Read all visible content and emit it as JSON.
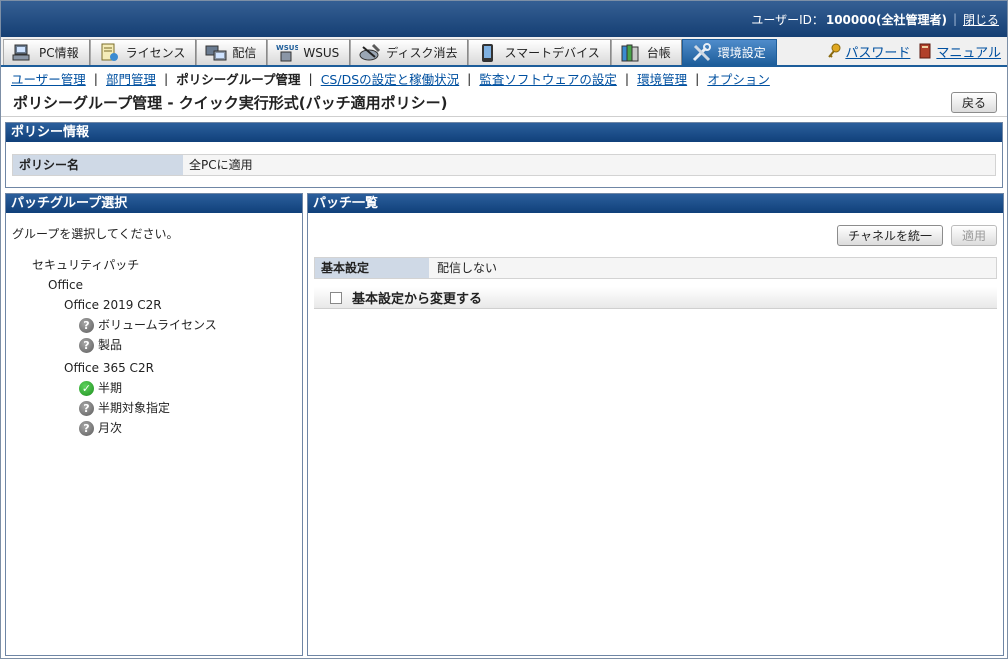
{
  "header": {
    "user_label": "ユーザーID：",
    "user_id": "100000(全社管理者)",
    "close_label": "閉じる"
  },
  "tabs": [
    {
      "label": "PC情報",
      "icon": "pc-icon"
    },
    {
      "label": "ライセンス",
      "icon": "license-icon"
    },
    {
      "label": "配信",
      "icon": "distribution-icon"
    },
    {
      "label": "WSUS",
      "icon": "wsus-icon"
    },
    {
      "label": "ディスク消去",
      "icon": "disk-erase-icon"
    },
    {
      "label": "スマートデバイス",
      "icon": "smart-device-icon"
    },
    {
      "label": "台帳",
      "icon": "ledger-icon"
    },
    {
      "label": "環境設定",
      "icon": "settings-tools-icon",
      "active": true
    }
  ],
  "tab_links": {
    "password": "パスワード",
    "manual": "マニュアル"
  },
  "subnav": {
    "items": [
      "ユーザー管理",
      "部門管理",
      "ポリシーグループ管理",
      "CS/DSの設定と稼働状況",
      "監査ソフトウェアの設定",
      "環境管理",
      "オプション"
    ],
    "current_index": 2
  },
  "page": {
    "title": "ポリシーグループ管理 - クイック実行形式(パッチ適用ポリシー)",
    "back_label": "戻る"
  },
  "policy_info": {
    "heading": "ポリシー情報",
    "name_label": "ポリシー名",
    "name_value": "全PCに適用"
  },
  "patch_group": {
    "heading": "パッチグループ選択",
    "hint": "グループを選択してください。",
    "root": "セキュリティパッチ",
    "product": "Office",
    "groups": [
      {
        "name": "Office 2019 C2R",
        "items": [
          {
            "label": "ボリュームライセンス",
            "status": "unknown"
          },
          {
            "label": "製品",
            "status": "unknown"
          }
        ]
      },
      {
        "name": "Office 365 C2R",
        "items": [
          {
            "label": "半期",
            "status": "ok"
          },
          {
            "label": "半期対象指定",
            "status": "unknown"
          },
          {
            "label": "月次",
            "status": "unknown"
          }
        ]
      }
    ]
  },
  "patch_list": {
    "heading": "パッチ一覧",
    "unify_channel_label": "チャネルを統一",
    "apply_label": "適用",
    "basic_setting_label": "基本設定",
    "basic_setting_value": "配信しない",
    "change_checkbox_label": "基本設定から変更する",
    "change_checked": false
  }
}
